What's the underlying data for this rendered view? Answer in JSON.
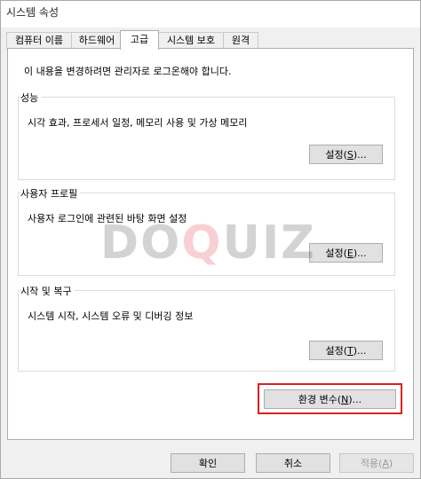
{
  "window": {
    "title": "시스템 속성"
  },
  "tabs": [
    {
      "label": "컴퓨터 이름",
      "active": false
    },
    {
      "label": "하드웨어",
      "active": false
    },
    {
      "label": "고급",
      "active": true
    },
    {
      "label": "시스템 보호",
      "active": false
    },
    {
      "label": "원격",
      "active": false
    }
  ],
  "advanced": {
    "notice": "이 내용을 변경하려면 관리자로 로그온해야 합니다.",
    "performance": {
      "title": "성능",
      "description": "시각 효과, 프로세서 일정, 메모리 사용 및 가상 메모리",
      "button_label": "설정(S)...",
      "button_prefix": "설정(",
      "button_key": "S",
      "button_suffix": ")..."
    },
    "user_profiles": {
      "title": "사용자 프로필",
      "description": "사용자 로그인에 관련된 바탕 화면 설정",
      "button_prefix": "설정(",
      "button_key": "E",
      "button_suffix": ")..."
    },
    "startup_recovery": {
      "title": "시작 및 복구",
      "description": "시스템 시작, 시스템 오류 및 디버깅 정보",
      "button_prefix": "설정(",
      "button_key": "T",
      "button_suffix": ")..."
    },
    "env_vars": {
      "prefix": "환경 변수(",
      "key": "N",
      "suffix": ")..."
    }
  },
  "footer": {
    "ok_label": "확인",
    "cancel_label": "취소",
    "apply_prefix": "적용(",
    "apply_key": "A",
    "apply_suffix": ")"
  },
  "watermark": {
    "part1": "DO",
    "part2": "Q",
    "part3": "UIZ"
  },
  "colors": {
    "highlight": "#d9211e",
    "watermark_red": "#e0303b"
  }
}
